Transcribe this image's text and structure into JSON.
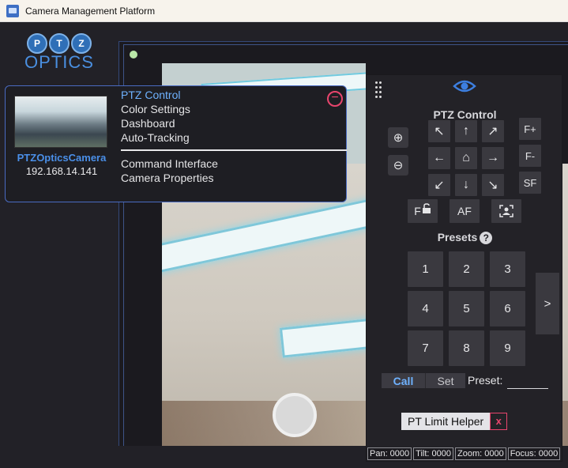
{
  "window": {
    "title": "Camera Management Platform"
  },
  "logo": {
    "letters": [
      "P",
      "T",
      "Z"
    ],
    "word": "OPTICS"
  },
  "camera": {
    "name": "PTZOpticsCamera",
    "ip": "192.168.14.141",
    "remove_symbol": "−",
    "menu": [
      "PTZ Control",
      "Color Settings",
      "Dashboard",
      "Auto-Tracking"
    ],
    "menu_secondary": [
      "Command Interface",
      "Camera Properties"
    ]
  },
  "ptz": {
    "title": "PTZ Control",
    "arrows": {
      "up_left": "↖",
      "up": "↑",
      "up_right": "↗",
      "left": "←",
      "home": "⌂",
      "right": "→",
      "down_left": "↙",
      "down": "↓",
      "down_right": "↘"
    },
    "zoom_in_icon": "⊕",
    "zoom_out_icon": "⊖",
    "focus": {
      "far": "F+",
      "near": "F-",
      "sf": "SF",
      "af": "AF",
      "focus_lock": "F"
    },
    "presets_title": "Presets",
    "help": "?",
    "presets": [
      "1",
      "2",
      "3",
      "4",
      "5",
      "6",
      "7",
      "8",
      "9"
    ],
    "next": ">",
    "call": "Call",
    "set": "Set",
    "preset_label": "Preset:",
    "preset_value": "",
    "pt_limit": "PT Limit Helper",
    "pt_limit_close": "x",
    "status": [
      "Pan: 0000",
      "Tilt: 0000",
      "Zoom: 0000",
      "Focus: 0000"
    ]
  },
  "colors": {
    "accent": "#4a8fe8",
    "danger": "#e8456d",
    "status_dot": "#b9e7a7"
  }
}
